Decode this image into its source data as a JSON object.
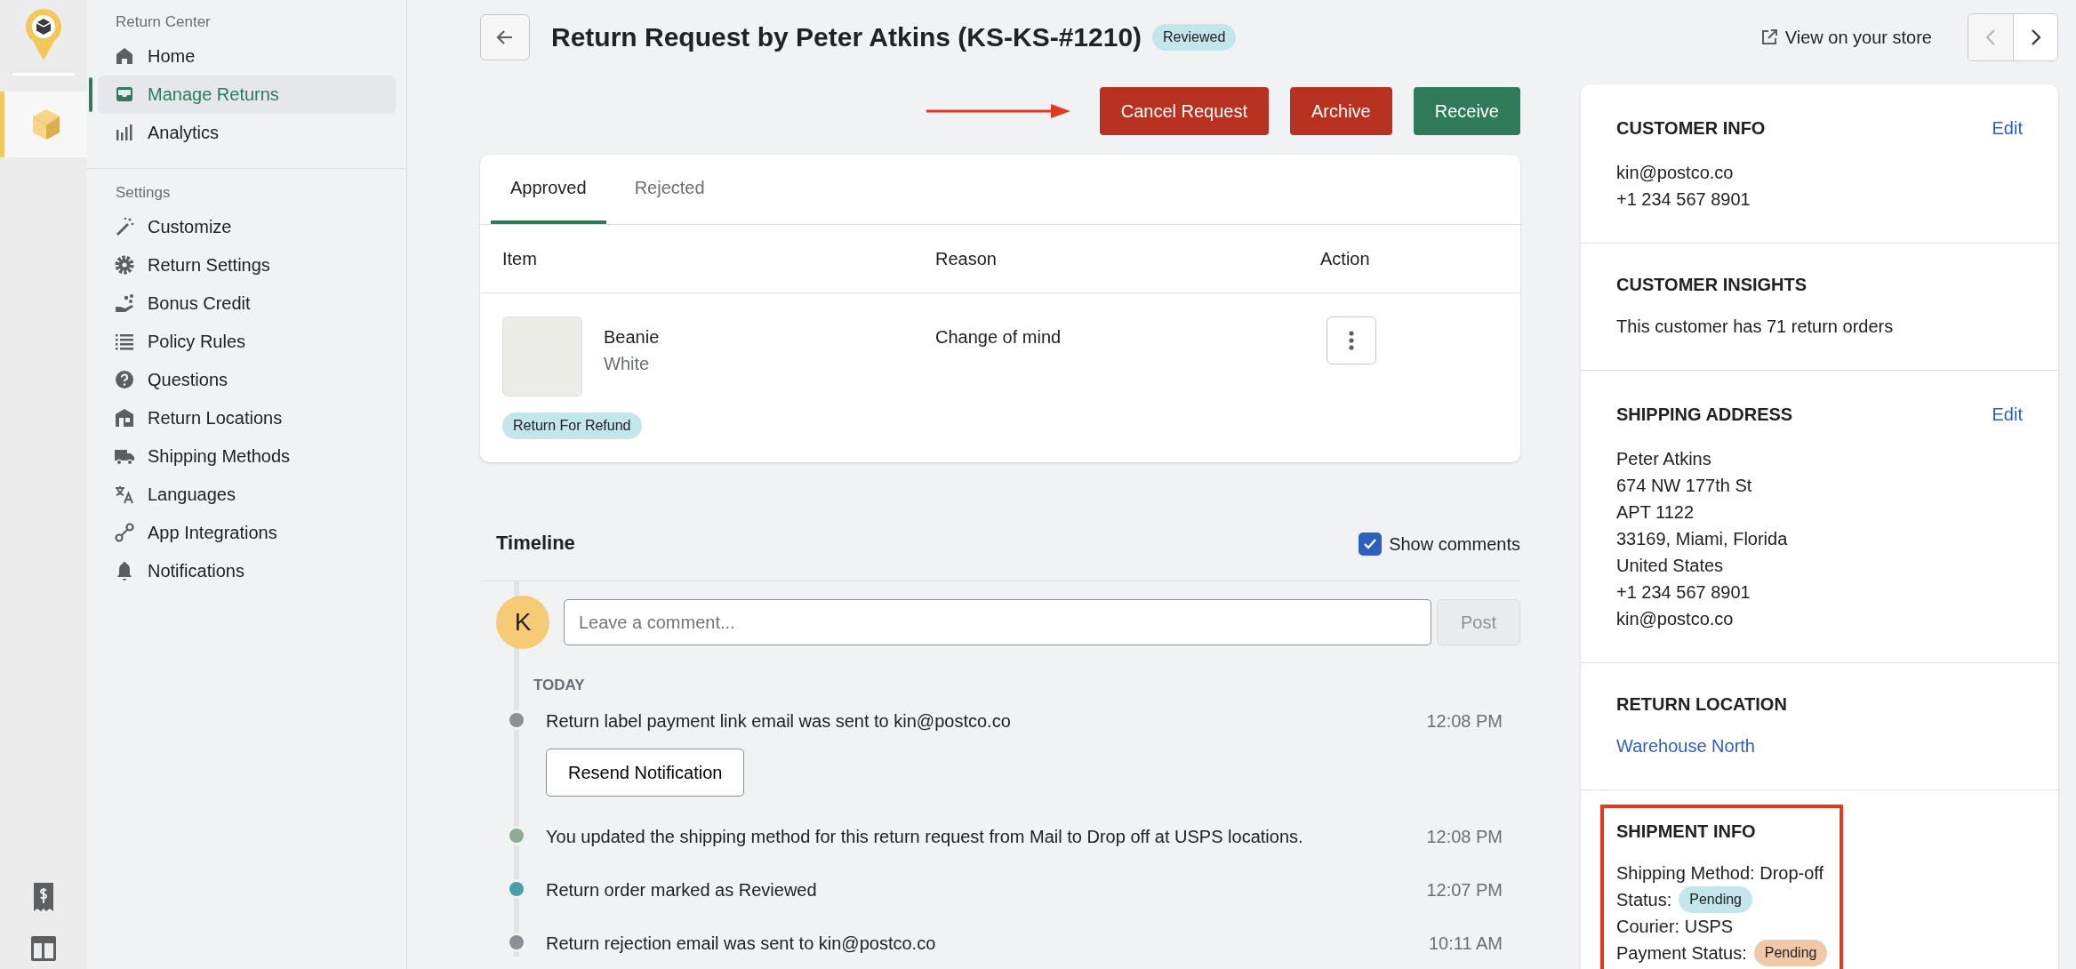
{
  "rail_items": [
    {
      "selected": true
    }
  ],
  "sidebar": {
    "sections": [
      {
        "title": "Return Center",
        "items": [
          {
            "label": "Home",
            "kind": "home",
            "selected": false
          },
          {
            "label": "Manage Returns",
            "kind": "inbox",
            "selected": true
          },
          {
            "label": "Analytics",
            "kind": "bars",
            "selected": false
          }
        ]
      },
      {
        "title": "Settings",
        "items": [
          {
            "label": "Customize",
            "kind": "wand",
            "selected": false
          },
          {
            "label": "Return Settings",
            "kind": "gear",
            "selected": false
          },
          {
            "label": "Bonus Credit",
            "kind": "hand",
            "selected": false
          },
          {
            "label": "Policy Rules",
            "kind": "list",
            "selected": false
          },
          {
            "label": "Questions",
            "kind": "question",
            "selected": false
          },
          {
            "label": "Return Locations",
            "kind": "building",
            "selected": false
          },
          {
            "label": "Shipping Methods",
            "kind": "truck",
            "selected": false
          },
          {
            "label": "Languages",
            "kind": "translate",
            "selected": false
          },
          {
            "label": "App Integrations",
            "kind": "link",
            "selected": false
          },
          {
            "label": "Notifications",
            "kind": "bell",
            "selected": false
          }
        ]
      }
    ]
  },
  "header": {
    "title": "Return Request by Peter Atkins (KS-KS-#1210)",
    "status": "Reviewed",
    "store_link": "View on your store"
  },
  "actions": [
    {
      "label": "Cancel Request",
      "kind": "danger",
      "pointed": true
    },
    {
      "label": "Archive",
      "kind": "danger",
      "pointed": false
    },
    {
      "label": "Receive",
      "kind": "success",
      "pointed": false
    }
  ],
  "tabs": [
    {
      "label": "Approved",
      "selected": true
    },
    {
      "label": "Rejected",
      "selected": false
    }
  ],
  "table": {
    "columns": [
      "Item",
      "Reason",
      "Action"
    ],
    "rows": [
      {
        "name": "Beanie",
        "variant": "White",
        "reason": "Change of mind",
        "tag": "Return For Refund"
      }
    ]
  },
  "timeline": {
    "title": "Timeline",
    "show_comments": {
      "label": "Show comments",
      "checked": true
    },
    "avatar": "K",
    "comment_placeholder": "Leave a comment...",
    "post_button": {
      "label": "Post",
      "disabled": true
    },
    "group": "TODAY",
    "events": [
      {
        "text": "Return label payment link email was sent to kin@postco.co",
        "time": "12:08 PM",
        "color": "#8e8f94",
        "action": "Resend Notification"
      },
      {
        "text": "You updated the shipping method for this return request from Mail to Drop off at USPS locations.",
        "time": "12:08 PM",
        "color": "#8fac93"
      },
      {
        "text": "Return order marked as Reviewed",
        "time": "12:07 PM",
        "color": "#4a9fa8"
      },
      {
        "text": "Return rejection email was sent to kin@postco.co",
        "time": "10:11 AM",
        "color": "#8e8f94"
      }
    ]
  },
  "panel": [
    {
      "title": "CUSTOMER INFO",
      "edit": "Edit",
      "kind": "lines",
      "highlighted": false,
      "lines": [
        "kin@postco.co",
        "+1 234 567 8901"
      ]
    },
    {
      "title": "CUSTOMER INSIGHTS",
      "kind": "lines",
      "highlighted": false,
      "lines": [
        "This customer has 71 return orders"
      ]
    },
    {
      "title": "SHIPPING ADDRESS",
      "edit": "Edit",
      "kind": "lines",
      "highlighted": false,
      "lines": [
        "Peter Atkins",
        "674 NW 177th St",
        "APT 1122",
        "33169, Miami, Florida",
        "United States",
        "+1 234 567 8901",
        "kin@postco.co"
      ]
    },
    {
      "title": "RETURN LOCATION",
      "kind": "link",
      "highlighted": false,
      "link": "Warehouse North"
    },
    {
      "title": "SHIPMENT INFO",
      "kind": "fields",
      "highlighted": true,
      "fields": [
        {
          "text": "Shipping Method: Drop-off"
        },
        {
          "text": "Status:",
          "badge": "Pending",
          "color": "#c3e6ec"
        },
        {
          "text": "Courier: USPS"
        },
        {
          "text": "Payment Status:",
          "badge": "Pending",
          "color": "#f2c9a8"
        }
      ]
    }
  ]
}
